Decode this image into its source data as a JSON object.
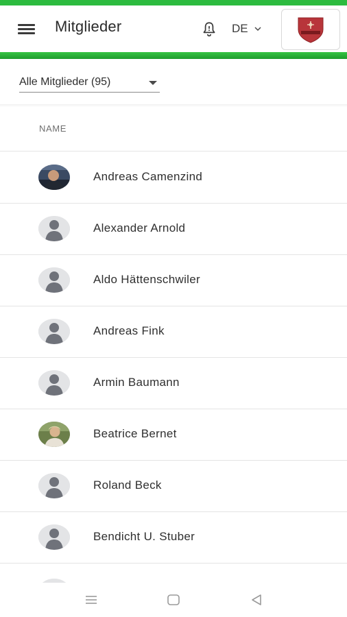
{
  "app": {
    "title": "Mitglieder",
    "language": "DE",
    "accent_color": "#2dbb3f",
    "icons": {
      "menu": "hamburger-menu-icon",
      "notifications": "bell-icon",
      "language_dropdown": "chevron-down-icon",
      "club": "club-shield-logo"
    }
  },
  "filter": {
    "label": "Alle Mitglieder (95)"
  },
  "table": {
    "column_header": "NAME",
    "rows": [
      {
        "name": "Andreas Camenzind",
        "avatar": "photo"
      },
      {
        "name": "Alexander Arnold",
        "avatar": "placeholder"
      },
      {
        "name": "Aldo Hättenschwiler",
        "avatar": "placeholder"
      },
      {
        "name": "Andreas Fink",
        "avatar": "placeholder"
      },
      {
        "name": "Armin Baumann",
        "avatar": "placeholder"
      },
      {
        "name": "Beatrice Bernet",
        "avatar": "photo"
      },
      {
        "name": "Roland Beck",
        "avatar": "placeholder"
      },
      {
        "name": "Bendicht U. Stuber",
        "avatar": "placeholder"
      }
    ]
  },
  "system_nav": {
    "icons": [
      "recents-icon",
      "home-icon",
      "back-icon"
    ]
  }
}
